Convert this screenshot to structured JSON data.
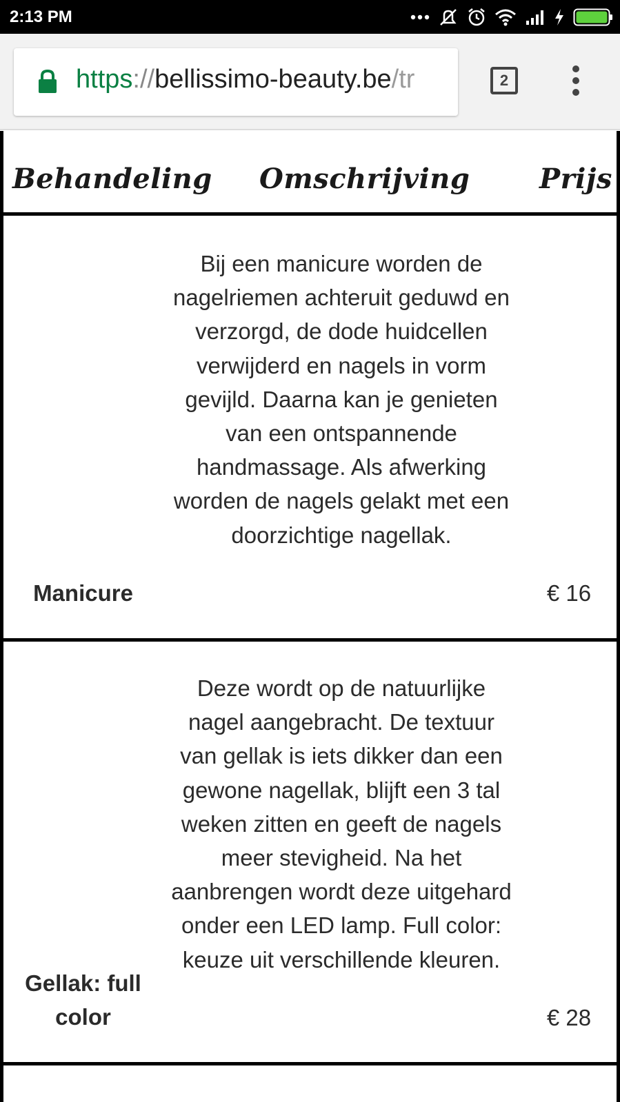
{
  "status_bar": {
    "time": "2:13 PM",
    "icons": [
      "more-notifications-icon",
      "vibrate-off-icon",
      "alarm-icon",
      "wifi-icon",
      "signal-icon",
      "charging-icon",
      "battery-icon"
    ]
  },
  "browser": {
    "url_scheme": "https",
    "url_sep": "://",
    "url_host": "bellissimo-beauty.be",
    "url_path": "/tr",
    "tab_count": "2"
  },
  "table": {
    "headers": {
      "treatment": "Behandeling",
      "description": "Omschrijving",
      "price": "Prijs"
    },
    "rows": [
      {
        "name": "Manicure",
        "description": "Bij een manicure worden de nagelriemen achteruit geduwd en verzorgd, de dode huidcellen verwijderd en nagels in vorm gevijld. Daarna kan je genieten van een ontspannende handmassage. Als afwerking worden de nagels gelakt met een doorzichtige nagellak.",
        "price": "€ 16"
      },
      {
        "name": "Gellak: full color",
        "description": "Deze wordt op de natuurlijke nagel aangebracht. De textuur van gellak is iets dikker dan een gewone nagellak, blijft een 3 tal weken zitten en geeft de nagels meer stevigheid. Na het aanbrengen wordt deze uitgehard onder een LED lamp. Full color: keuze uit verschillende kleuren.",
        "price": "€ 28"
      }
    ]
  },
  "colors": {
    "status_bar_bg": "#000000",
    "secure_green": "#0b8043",
    "chrome_bg": "#f2f2f2",
    "text": "#2b2b2b"
  }
}
